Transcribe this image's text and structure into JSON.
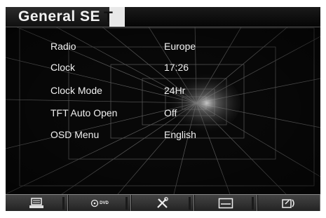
{
  "title": {
    "text_main": "General SE",
    "text_accent": "T"
  },
  "settings": [
    {
      "label": "Radio",
      "value": "Europe"
    },
    {
      "label": "Clock",
      "value": "17:26"
    },
    {
      "label": "Clock  Mode",
      "value": "24Hr"
    },
    {
      "label": "TFT  Auto  Open",
      "value": "Off"
    },
    {
      "label": "OSD  Menu",
      "value": "English"
    }
  ],
  "toolbar": {
    "items": [
      {
        "icon": "keyboard-icon"
      },
      {
        "icon": "dvd-icon",
        "label": "DVD"
      },
      {
        "icon": "tools-icon"
      },
      {
        "icon": "display-icon"
      },
      {
        "icon": "exit-icon"
      }
    ]
  }
}
